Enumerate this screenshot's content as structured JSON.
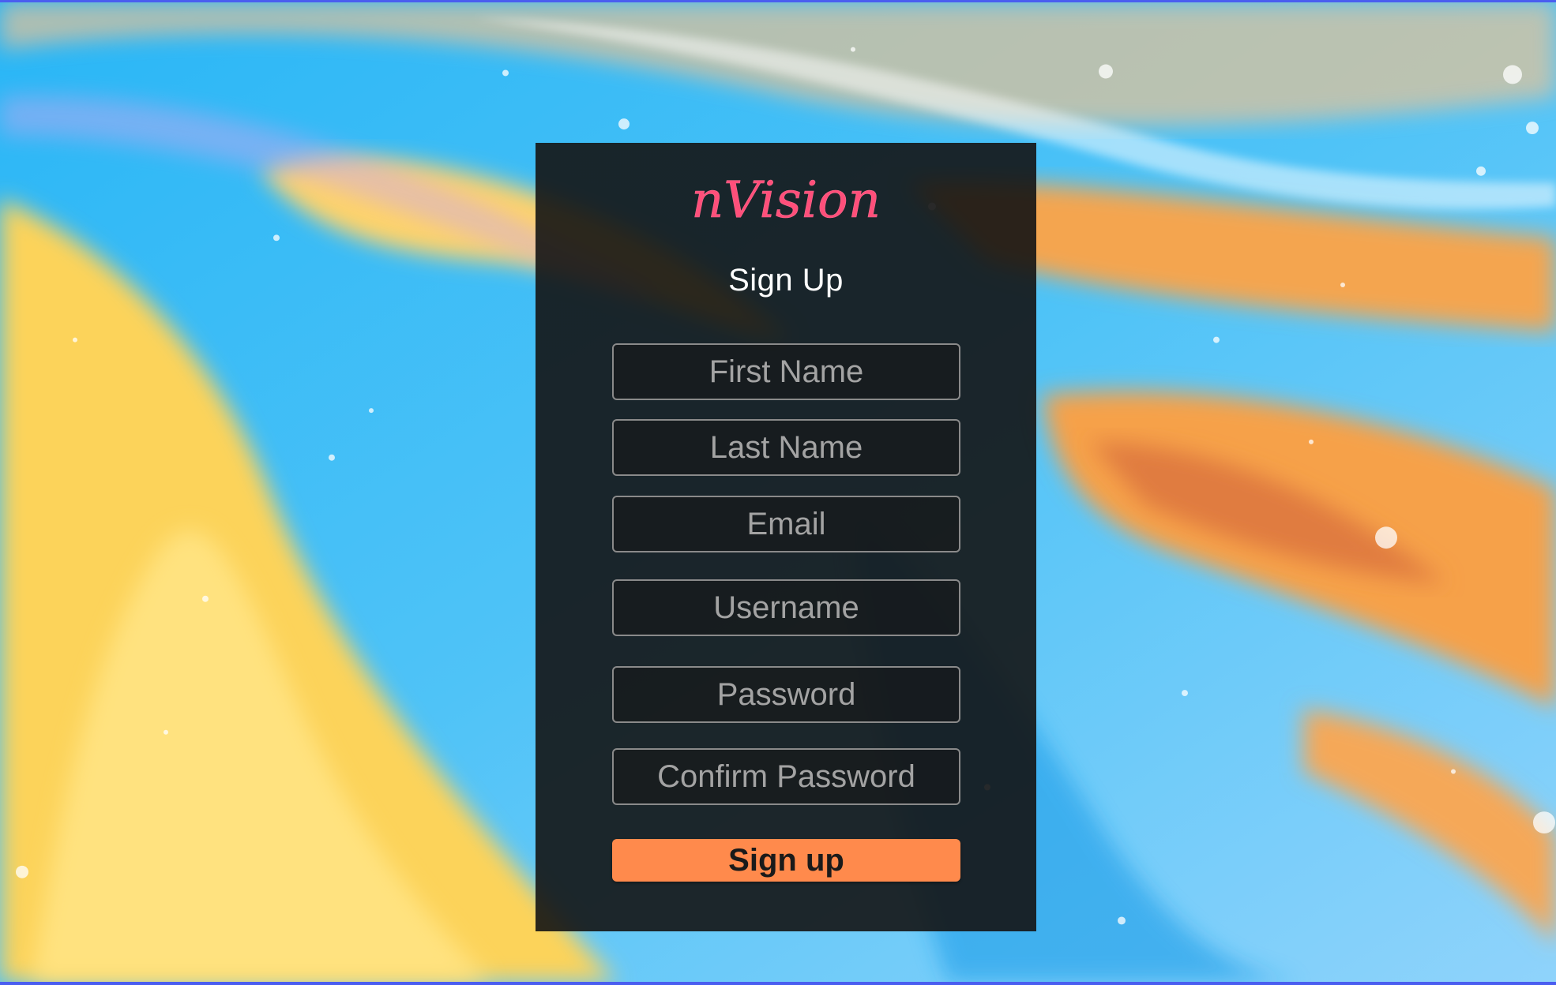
{
  "brand": {
    "logo_text": "nVision",
    "logo_color": "#ff4f7a"
  },
  "form": {
    "title": "Sign Up",
    "fields": {
      "first_name": {
        "placeholder": "First Name",
        "value": ""
      },
      "last_name": {
        "placeholder": "Last Name",
        "value": ""
      },
      "email": {
        "placeholder": "Email",
        "value": ""
      },
      "username": {
        "placeholder": "Username",
        "value": ""
      },
      "password": {
        "placeholder": "Password",
        "value": ""
      },
      "confirm_password": {
        "placeholder": "Confirm Password",
        "value": ""
      }
    },
    "submit_label": "Sign up"
  },
  "colors": {
    "accent": "#ff8a4c",
    "card_background": "#141414",
    "frame_border": "#4a5ef0"
  }
}
